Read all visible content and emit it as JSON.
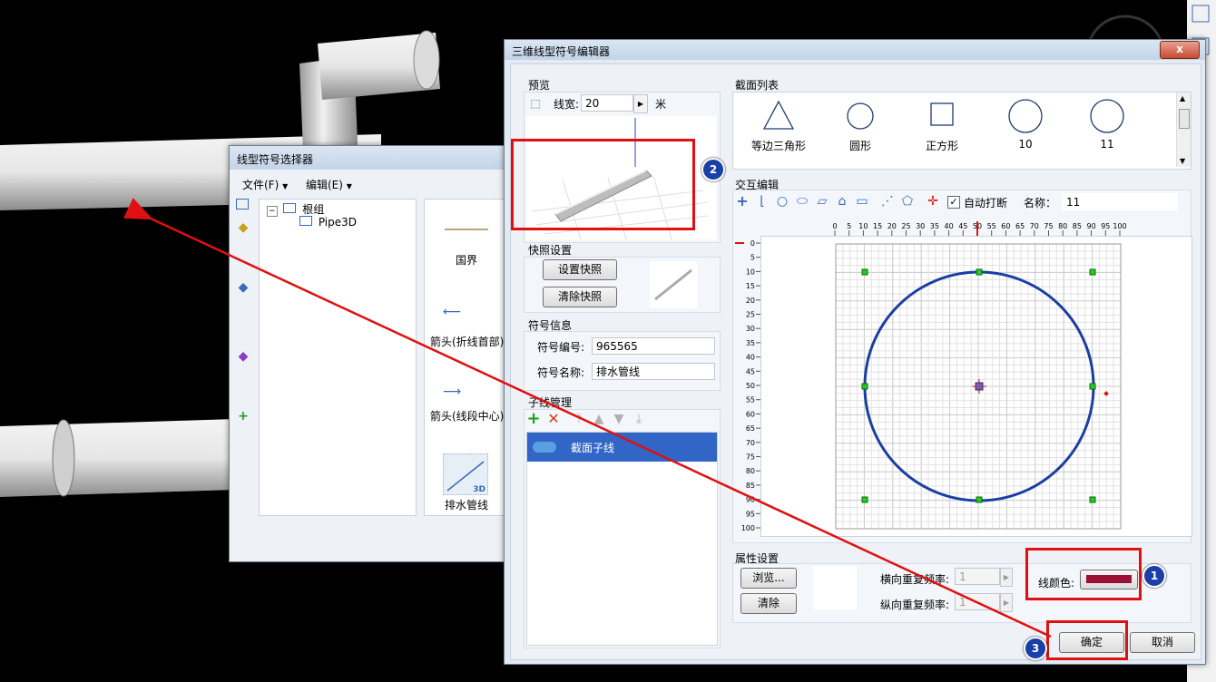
{
  "selector_window": {
    "title": "线型符号选择器",
    "menu": {
      "file": "文件(F)",
      "edit": "编辑(E)"
    },
    "tree": {
      "root": "根组",
      "child": "Pipe3D"
    },
    "items": [
      {
        "label": "国界"
      },
      {
        "label": "箭头(折线首部)"
      },
      {
        "label": "箭头(线段中心)"
      },
      {
        "label": "排水管线",
        "badge": "3D"
      }
    ]
  },
  "editor_window": {
    "title": "三维线型符号编辑器",
    "close_label": "x",
    "preview": {
      "group_label": "预览",
      "line_width_label": "线宽:",
      "line_width_value": "20",
      "unit": "米"
    },
    "snapshot": {
      "group_label": "快照设置",
      "set_button": "设置快照",
      "clear_button": "清除快照"
    },
    "symbol_info": {
      "group_label": "符号信息",
      "id_label": "符号编号:",
      "id_value": "965565",
      "name_label": "符号名称:",
      "name_value": "排水管线"
    },
    "subline": {
      "group_label": "子线管理",
      "items": [
        {
          "label": "截面子线"
        }
      ]
    },
    "section_list": {
      "group_label": "截面列表",
      "items": [
        {
          "label": "等边三角形",
          "shape": "triangle"
        },
        {
          "label": "圆形",
          "shape": "circle"
        },
        {
          "label": "正方形",
          "shape": "square"
        },
        {
          "label": "10",
          "shape": "circle"
        },
        {
          "label": "11",
          "shape": "circle"
        }
      ]
    },
    "interactive": {
      "group_label": "交互编辑",
      "auto_break_label": "自动打断",
      "auto_break_checked": true,
      "name_label": "名称：",
      "name_value": "11",
      "ruler_ticks": [
        "0",
        "5",
        "10",
        "15",
        "20",
        "25",
        "30",
        "35",
        "40",
        "45",
        "50",
        "55",
        "60",
        "65",
        "70",
        "75",
        "80",
        "85",
        "90",
        "95",
        "100"
      ]
    },
    "attributes": {
      "group_label": "属性设置",
      "browse_button": "浏览...",
      "clear_button": "清除",
      "h_repeat_label": "横向重复频率:",
      "h_repeat_value": "1",
      "v_repeat_label": "纵向重复频率:",
      "v_repeat_value": "1",
      "line_color_label": "线颜色:",
      "line_color": "#9b1037"
    },
    "ok_button": "确定",
    "cancel_button": "取消"
  },
  "badges": [
    "1",
    "2",
    "3"
  ],
  "colors": {
    "accent_blue": "#1a3fa8",
    "highlight_red": "#e01010",
    "selection": "#3166c6"
  }
}
